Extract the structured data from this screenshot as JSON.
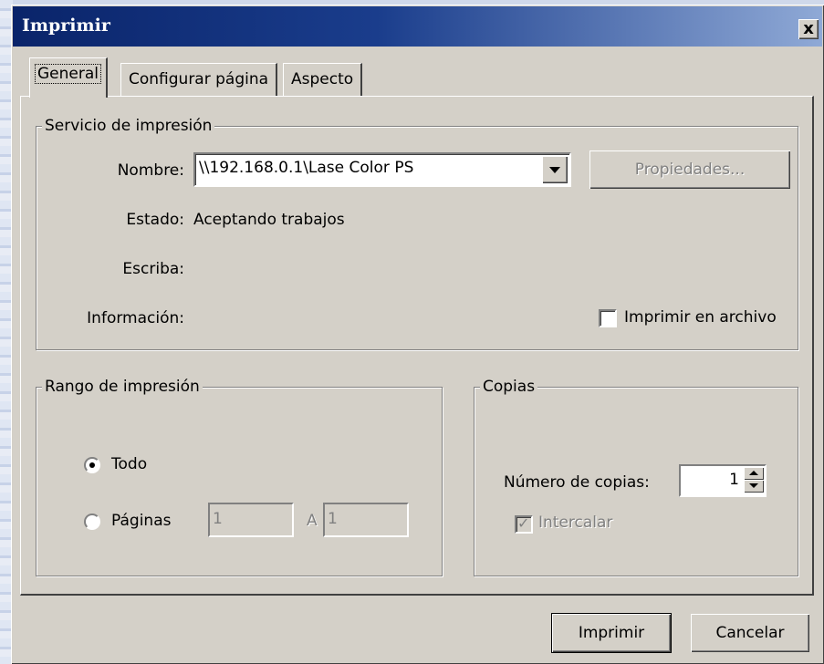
{
  "window": {
    "title": "Imprimir",
    "close_glyph": "x"
  },
  "tabs": [
    {
      "label": "General",
      "active": true
    },
    {
      "label": "Configurar página",
      "active": false
    },
    {
      "label": "Aspecto",
      "active": false
    }
  ],
  "print_service": {
    "legend": "Servicio de impresión",
    "name_label": "Nombre:",
    "name_value": "\\\\192.168.0.1\\Lase Color PS",
    "properties_label": "Propiedades...",
    "status_label": "Estado:",
    "status_value": "Aceptando trabajos",
    "type_label": "Escriba:",
    "info_label": "Información:",
    "print_to_file_label": "Imprimir en archivo",
    "print_to_file_checked": false
  },
  "print_range": {
    "legend": "Rango de impresión",
    "all_label": "Todo",
    "pages_label": "Páginas",
    "from_value": "1",
    "to_label": "A",
    "to_value": "1",
    "selected": "all"
  },
  "copies": {
    "legend": "Copias",
    "count_label": "Número de copias:",
    "count_value": "1",
    "collate_label": "Intercalar",
    "collate_checked": true
  },
  "buttons": {
    "print": "Imprimir",
    "cancel": "Cancelar"
  },
  "colors": {
    "titlebar": "#0a246a",
    "face": "#d4d0c8"
  }
}
